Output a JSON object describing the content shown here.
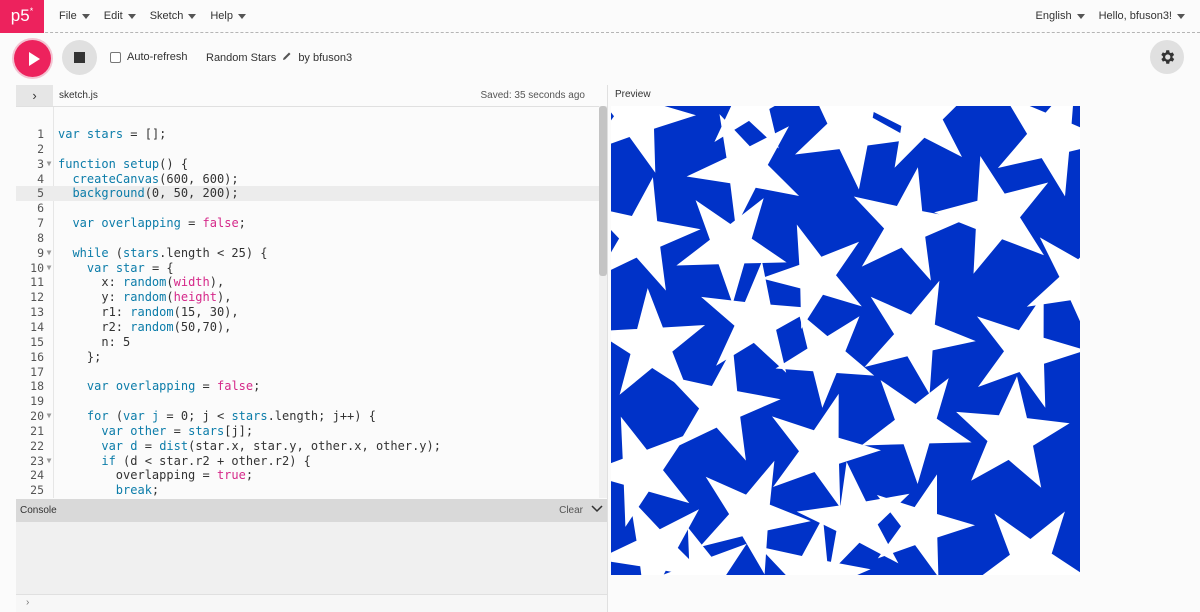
{
  "logo": {
    "text": "p5",
    "sup": "*"
  },
  "menu": [
    {
      "label": "File"
    },
    {
      "label": "Edit"
    },
    {
      "label": "Sketch"
    },
    {
      "label": "Help"
    }
  ],
  "nav_right": [
    {
      "label": "English"
    },
    {
      "label": "Hello, bfuson3!"
    }
  ],
  "toolbar": {
    "auto_refresh_label": "Auto-refresh",
    "sketch_name": "Random Stars",
    "by_label": "by bfuson3"
  },
  "editor": {
    "filename": "sketch.js",
    "saved_status": "Saved: 35 seconds ago",
    "active_line": 5
  },
  "preview": {
    "label": "Preview",
    "background_color": "#0032c8",
    "star_color": "#ffffff"
  },
  "console": {
    "title": "Console",
    "clear_label": "Clear"
  },
  "colors": {
    "brand": "#ed225d"
  }
}
